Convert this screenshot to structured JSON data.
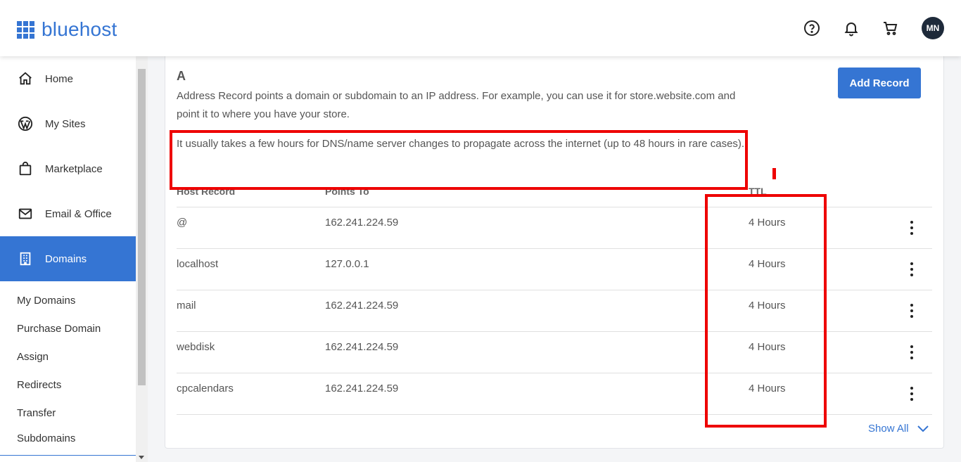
{
  "header": {
    "logo_text": "bluehost",
    "help_icon": "help-circle-icon",
    "bell_icon": "bell-icon",
    "cart_icon": "cart-icon",
    "avatar_initials": "MN",
    "brand_color": "#3575d3"
  },
  "sidebar": {
    "nav": [
      {
        "label": "Home",
        "icon": "home-icon"
      },
      {
        "label": "My Sites",
        "icon": "wordpress-icon"
      },
      {
        "label": "Marketplace",
        "icon": "shopping-bag-icon"
      },
      {
        "label": "Email & Office",
        "icon": "mail-icon"
      },
      {
        "label": "Domains",
        "icon": "building-icon",
        "active": true
      }
    ],
    "sub_items": [
      "My Domains",
      "Purchase Domain",
      "Assign",
      "Redirects",
      "Transfer",
      "Subdomains"
    ]
  },
  "record": {
    "type": "A",
    "description": "Address Record points a domain or subdomain to an IP address. For example, you can use it for store.website.com and point it to where you have your store.",
    "note": "It usually takes a few hours for DNS/name server changes to propagate across the internet (up to 48 hours in rare cases).",
    "add_button": "Add Record"
  },
  "table": {
    "headers": [
      "Host Record",
      "Points To",
      "TTL"
    ],
    "rows": [
      {
        "host": "@",
        "points_to": "162.241.224.59",
        "ttl": "4 Hours"
      },
      {
        "host": "localhost",
        "points_to": "127.0.0.1",
        "ttl": "4 Hours"
      },
      {
        "host": "mail",
        "points_to": "162.241.224.59",
        "ttl": "4 Hours"
      },
      {
        "host": "webdisk",
        "points_to": "162.241.224.59",
        "ttl": "4 Hours"
      },
      {
        "host": "cpcalendars",
        "points_to": "162.241.224.59",
        "ttl": "4 Hours"
      }
    ],
    "show_all": "Show All"
  },
  "annotation_color": "#ee0000"
}
